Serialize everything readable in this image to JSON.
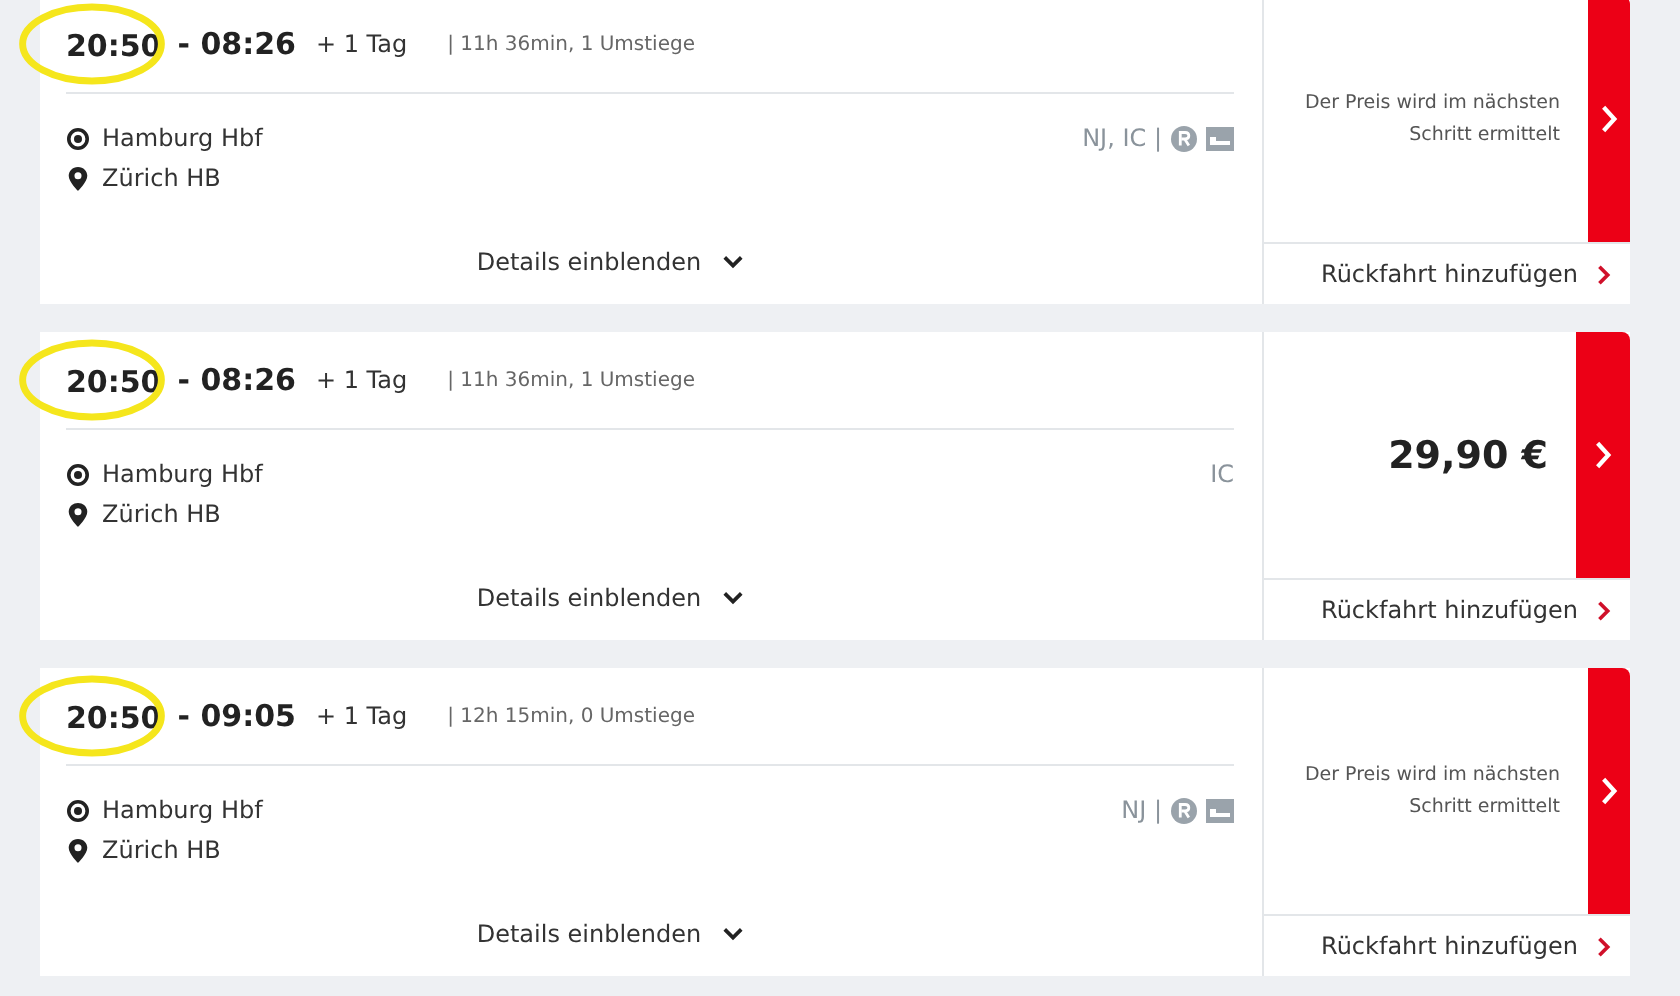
{
  "connections": [
    {
      "departure": "20:50",
      "arrival": "- 08:26",
      "day_offset": "+ 1 Tag",
      "summary": "| 11h 36min, 1 Umstiege",
      "highlighted": true,
      "from": "Hamburg Hbf",
      "to": "Zürich HB",
      "products": "NJ, IC |",
      "reservation_icon": true,
      "sleeper_icon": true,
      "details": "Details einblenden",
      "price": {
        "kind": "pending",
        "text": "Der Preis wird im nächsten Schritt ermittelt"
      },
      "return_link": "Rückfahrt hinzufügen"
    },
    {
      "departure": "20:50",
      "arrival": "- 08:26",
      "day_offset": "+ 1 Tag",
      "summary": "| 11h 36min, 1 Umstiege",
      "highlighted": true,
      "from": "Hamburg Hbf",
      "to": "Zürich HB",
      "products": "IC",
      "reservation_icon": false,
      "sleeper_icon": false,
      "details": "Details einblenden",
      "price": {
        "kind": "amount",
        "text": "29,90 €"
      },
      "return_link": "Rückfahrt hinzufügen"
    },
    {
      "departure": "20:50",
      "arrival": "- 09:05",
      "day_offset": "+ 1 Tag",
      "summary": "| 12h 15min, 0 Umstiege",
      "highlighted": true,
      "from": "Hamburg Hbf",
      "to": "Zürich HB",
      "products": "NJ |",
      "reservation_icon": true,
      "sleeper_icon": true,
      "details": "Details einblenden",
      "price": {
        "kind": "pending",
        "text": "Der Preis wird im nächsten Schritt ermittelt"
      },
      "return_link": "Rückfahrt hinzufügen"
    }
  ]
}
